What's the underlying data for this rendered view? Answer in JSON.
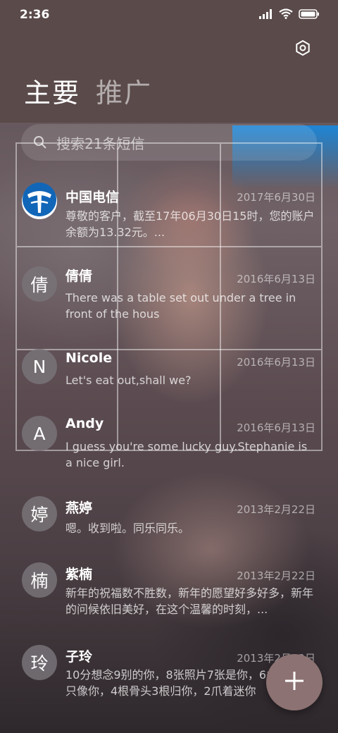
{
  "status_bar": {
    "time": "2:36"
  },
  "tabs": [
    {
      "label": "主要"
    },
    {
      "label": "推广"
    }
  ],
  "search": {
    "placeholder": "搜索21条短信"
  },
  "colors": {
    "header": "#5a4a4a",
    "fab": "#8c7272",
    "telecom_blue": "#1166b8"
  },
  "messages": [
    {
      "avatar": "",
      "avatar_icon": "china-telecom-logo-icon",
      "name": "中国电信",
      "date": "2017年6月30日",
      "preview": "尊敬的客户，截至17年06月30日15时，您的账户余额为13.32元。..."
    },
    {
      "avatar": "倩",
      "name": "倩倩",
      "date": "2016年6月13日",
      "preview": "There was a table set out under a tree in front of the hous"
    },
    {
      "avatar": "N",
      "name": "Nicole",
      "date": "2016年6月13日",
      "preview": "Let's eat out,shall we?"
    },
    {
      "avatar": "A",
      "name": "Andy",
      "date": "2016年6月13日",
      "preview": "I guess you're some lucky guy.Stephanie is a nice girl."
    },
    {
      "avatar": "婷",
      "name": "燕婷",
      "date": "2013年2月22日",
      "preview": "嗯。收到啦。同乐同乐。"
    },
    {
      "avatar": "楠",
      "name": "紫楠",
      "date": "2013年2月22日",
      "preview": "新年的祝福数不胜数，新年的愿望好多好多，新年的问候依旧美好，在这个温馨的时刻，..."
    },
    {
      "avatar": "玲",
      "name": "子玲",
      "date": "2013年2月22日",
      "preview": "10分想念9别的你，8张照片7张是你，6条小狗5只像你，4根骨头3根归你，2爪着迷你"
    }
  ],
  "icons": {
    "settings": "gear-icon",
    "search": "search-icon",
    "compose": "plus-icon"
  }
}
